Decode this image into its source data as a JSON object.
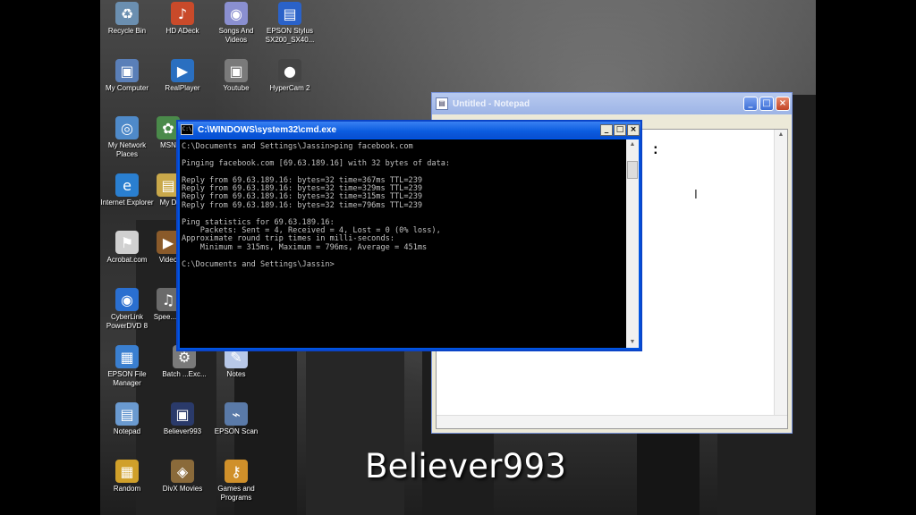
{
  "desktop_icons": [
    {
      "label": "Recycle Bin",
      "icon": "recycle-bin-icon",
      "glyph": "♻",
      "color": "#6b8fb0"
    },
    {
      "label": "HD ADeck",
      "icon": "hd-adeck-icon",
      "glyph": "♪",
      "color": "#c94a2a"
    },
    {
      "label": "Songs And Videos",
      "icon": "cd-icon",
      "glyph": "◉",
      "color": "#8a8fd0"
    },
    {
      "label": "EPSON Stylus SX200_SX40...",
      "icon": "printer-icon",
      "glyph": "▤",
      "color": "#2a62c9"
    },
    {
      "label": "My Computer",
      "icon": "computer-icon",
      "glyph": "▣",
      "color": "#5a7fb8"
    },
    {
      "label": "RealPlayer",
      "icon": "realplayer-icon",
      "glyph": "▶",
      "color": "#2a6fc0"
    },
    {
      "label": "Youtube",
      "icon": "youtube-icon",
      "glyph": "▣",
      "color": "#7a7a7a"
    },
    {
      "label": "HyperCam 2",
      "icon": "camera-icon",
      "glyph": "●",
      "color": "#444"
    },
    {
      "label": "My Network Places",
      "icon": "network-icon",
      "glyph": "◎",
      "color": "#4f8ac9"
    },
    {
      "label": "MSN",
      "icon": "msn-icon",
      "glyph": "✿",
      "color": "#4a8a4a"
    },
    {
      "label": "Internet Explorer",
      "icon": "internet-explorer-icon",
      "glyph": "e",
      "color": "#2a7fd0"
    },
    {
      "label": "My D",
      "icon": "document-icon",
      "glyph": "▤",
      "color": "#c9a84a"
    },
    {
      "label": "Acrobat.com",
      "icon": "acrobat-icon",
      "glyph": "⚑",
      "color": "#d0d0d0"
    },
    {
      "label": "Video",
      "icon": "video-icon",
      "glyph": "▶",
      "color": "#8a5a2a"
    },
    {
      "label": "CyberLink PowerDVD 8",
      "icon": "powerdvd-icon",
      "glyph": "◉",
      "color": "#2a6fd0"
    },
    {
      "label": "Spee... A",
      "icon": "speaker-icon",
      "glyph": "♫",
      "color": "#6a6a6a"
    },
    {
      "label": "EPSON File Manager",
      "icon": "file-manager-icon",
      "glyph": "▦",
      "color": "#3a7fd0"
    },
    {
      "label": "Batch ...Exc...",
      "icon": "batch-file-icon",
      "glyph": "⚙",
      "color": "#7a7a7a"
    },
    {
      "label": "Notes",
      "icon": "notes-icon",
      "glyph": "✎",
      "color": "#b8c8e8"
    },
    {
      "label": "Notepad",
      "icon": "notepad-icon",
      "glyph": "▤",
      "color": "#6a9ad0"
    },
    {
      "label": "Believer993",
      "icon": "user-folder-icon",
      "glyph": "▣",
      "color": "#2a3a6a"
    },
    {
      "label": "EPSON Scan",
      "icon": "scanner-icon",
      "glyph": "⌁",
      "color": "#5a7aa8"
    },
    {
      "label": "Random",
      "icon": "folder-icon",
      "glyph": "▦",
      "color": "#d0a02a"
    },
    {
      "label": "DivX Movies",
      "icon": "divx-icon",
      "glyph": "◈",
      "color": "#8a6a3a"
    },
    {
      "label": "Games and Programs",
      "icon": "key-icon",
      "glyph": "⚷",
      "color": "#d0902a"
    }
  ],
  "notepad": {
    "title": "Untitled - Notepad",
    "text": ":",
    "cursor": "I"
  },
  "cmd": {
    "title": "C:\\WINDOWS\\system32\\cmd.exe",
    "output": "C:\\Documents and Settings\\Jassin>ping facebook.com\n\nPinging facebook.com [69.63.189.16] with 32 bytes of data:\n\nReply from 69.63.189.16: bytes=32 time=367ms TTL=239\nReply from 69.63.189.16: bytes=32 time=329ms TTL=239\nReply from 69.63.189.16: bytes=32 time=315ms TTL=239\nReply from 69.63.189.16: bytes=32 time=796ms TTL=239\n\nPing statistics for 69.63.189.16:\n    Packets: Sent = 4, Received = 4, Lost = 0 (0% loss),\nApproximate round trip times in milli-seconds:\n    Minimum = 315ms, Maximum = 796ms, Average = 451ms\n\nC:\\Documents and Settings\\Jassin>"
  },
  "window_controls": {
    "minimize": "_",
    "maximize": "□",
    "close": "×"
  },
  "watermark": "Believer993"
}
